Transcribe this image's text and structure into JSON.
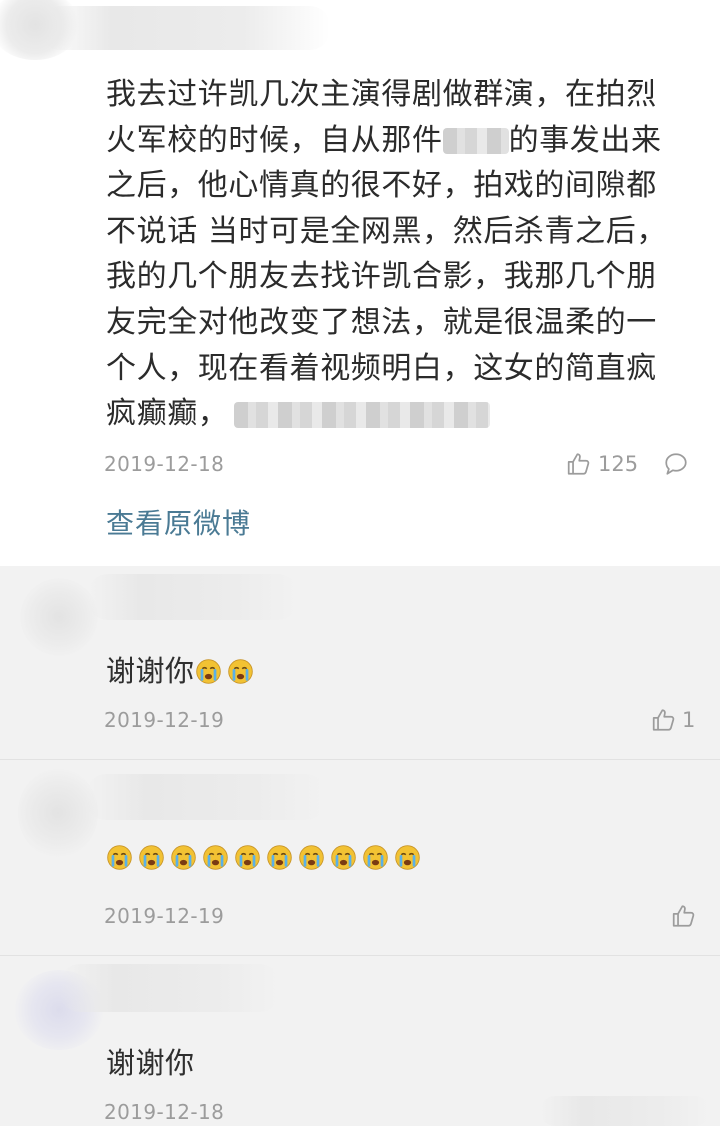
{
  "main": {
    "lines": [
      "我去过许凯几次主演得剧做群演，在拍烈",
      "火军校的时候，自从那件",
      "的事发出来",
      "之后，他心情真的很不好，拍戏的间隙都",
      "不说话 当时可是全网黑，然后杀青之后，",
      "我的几个朋友去找许凯合影，我那几个朋",
      "友完全对他改变了想法，就是很温柔的一",
      "个人，现在看着视频明白，这女的简直疯",
      "疯癫癫，"
    ],
    "date": "2019-12-18",
    "likes": "125",
    "view_link": "查看原微博"
  },
  "replies": [
    {
      "text": "谢谢你",
      "emoji": "crying-emoji",
      "emoji_count": 2,
      "date": "2019-12-19",
      "likes": "1"
    },
    {
      "text": "",
      "emoji": "crying-emoji",
      "emoji_count": 10,
      "date": "2019-12-19",
      "likes": ""
    },
    {
      "text": "谢谢你",
      "emoji": "",
      "emoji_count": 0,
      "date": "2019-12-18",
      "likes": ""
    }
  ],
  "colors": {
    "link": "#4a7a94",
    "meta": "#9c9c9c",
    "emoji_face": "#f2c233",
    "emoji_tear": "#5ab0e8"
  }
}
